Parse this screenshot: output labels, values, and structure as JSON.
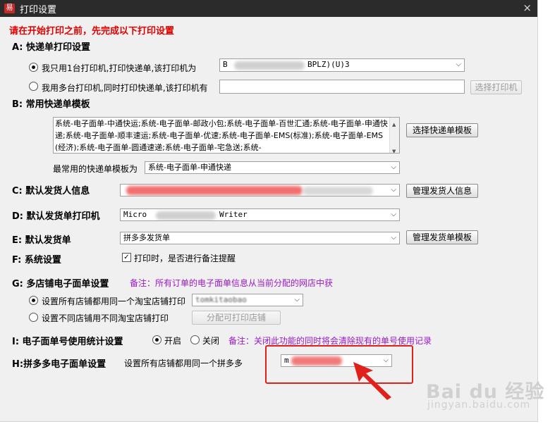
{
  "window": {
    "title": "打印设置",
    "app_icon_char": "易",
    "close_glyph": "×"
  },
  "notice": "请在开始打印之前，先完成以下打印设置",
  "section_a": {
    "title": "A: 快递单打印设置",
    "option_single": "我只用1台打印机,打印快递单,该打印机为",
    "option_single_selected": true,
    "printer_value_start": "B",
    "printer_value_end": "BPLZ)(U)3",
    "option_multi": "我用多台打印机,同时打印快递单,该打印机有",
    "select_printer_button": "选择打印机"
  },
  "section_b": {
    "title": "B: 常用快递单模板",
    "templates_text": "系统-电子面单-中通快运;系统-电子面单-邮政小包;系统-电子面单-百世汇通;系统-电子面单-申通快递;系统-电子面单-顺丰速运;系统-电子面单-优速;系统-电子面单-EMS(标准);系统-电子面单-EMS(经济);系统-电子面单-圆通速递;系统-电子面单-宅急送;系统-",
    "select_template_button": "选择快递单模板",
    "common_label": "最常用的快递单模板为",
    "common_value": "系统-电子面单-申通快递"
  },
  "section_c": {
    "title": "C: 默认发货人信息",
    "manage_button": "管理发货人信息"
  },
  "section_d": {
    "title": "D: 默认发货单打印机",
    "printer_value_start": "Micro",
    "printer_value_end": "Writer"
  },
  "section_e": {
    "title": "E: 默认发货单",
    "value": "拼多多发货单",
    "manage_button": "管理发货单模板"
  },
  "section_f": {
    "title": "F: 系统设置",
    "checkbox_label": "打印时，是否进行备注提醒",
    "checked": true
  },
  "section_g": {
    "title": "G: 多店铺电子面单设置",
    "note": "备注：所有订单的电子面单信息从当前分配的网店中获",
    "option_same": "设置所有店铺都用同一个淘宝店铺打印",
    "option_same_selected": true,
    "shop_value": "tomkitaobao",
    "option_diff": "设置不同店铺用不同淘宝店铺打印",
    "assign_button": "分配可打印店铺"
  },
  "section_i": {
    "title": "I: 电子面单号使用统计设置",
    "option_on": "开启",
    "option_on_selected": true,
    "option_off": "关闭",
    "note": "备注：关闭此功能的同时将会清除现有的单号使用记录"
  },
  "section_h": {
    "title": "H:拼多多电子面单设置",
    "label": "设置所有店铺都用同一个拼多多",
    "value_start": "m"
  },
  "dropdown_arrow": "⌵",
  "colors": {
    "notice_red": "#e00000",
    "note_purple": "#9b17c9",
    "annotation_red": "#e0201a"
  },
  "watermark": {
    "brand": "Bai du 经验",
    "url": "jingyan.baidu.com"
  }
}
